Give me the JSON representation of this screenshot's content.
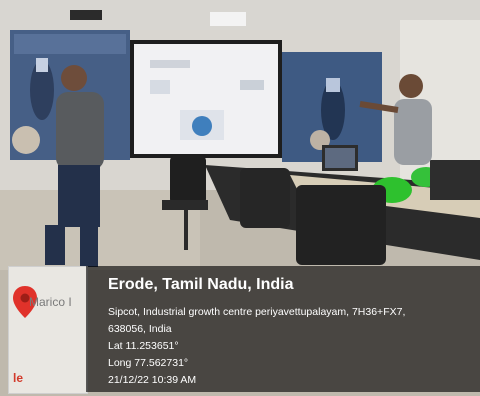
{
  "geotag": {
    "title": "Erode, Tamil Nadu, India",
    "address_line1": "Sipcot, Industrial growth centre periyavettupalayam, 7H36+FX7,",
    "address_line2": "638056, India",
    "lat": "Lat 11.253651°",
    "long": "Long 77.562731°",
    "timestamp": "21/12/22 10:39 AM"
  },
  "map_thumb": {
    "label": "Marico I",
    "corner_text": "le",
    "pin_color": "#e0322a"
  }
}
